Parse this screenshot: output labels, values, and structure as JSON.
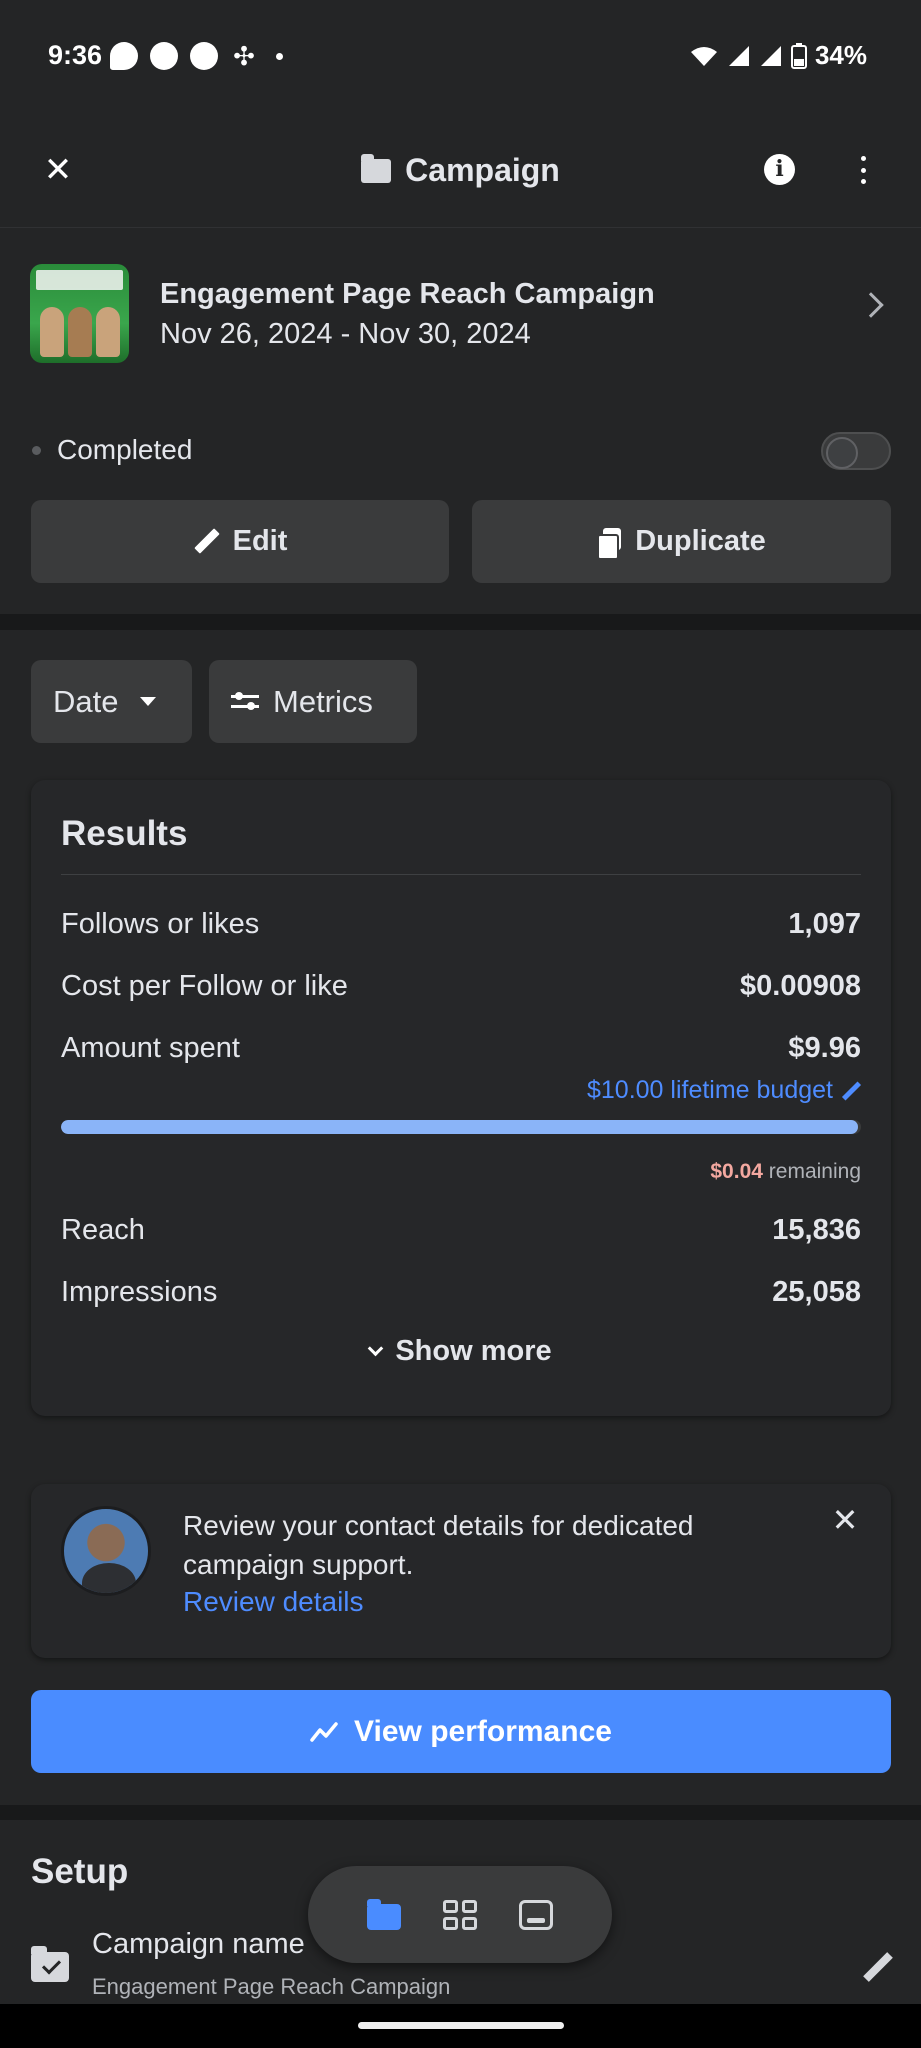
{
  "status_bar": {
    "time": "9:36",
    "battery": "34%",
    "left_icons": [
      "messenger-icon",
      "facebook-icon",
      "facebook-icon",
      "slack-icon",
      "notification-dot"
    ],
    "right_icons": [
      "wifi-icon",
      "signal-icon",
      "signal-icon",
      "battery-icon"
    ]
  },
  "header": {
    "title": "Campaign",
    "close_icon": "close-icon",
    "info_icon": "info-icon",
    "more_icon": "more-vertical-icon"
  },
  "campaign": {
    "name": "Engagement Page Reach Campaign",
    "dates": "Nov 26, 2024 - Nov 30, 2024",
    "status": "Completed",
    "toggle_on": false,
    "edit_label": "Edit",
    "duplicate_label": "Duplicate"
  },
  "filters": {
    "date_label": "Date",
    "metrics_label": "Metrics"
  },
  "results": {
    "title": "Results",
    "metrics": [
      {
        "label": "Follows or likes",
        "value": "1,097"
      },
      {
        "label": "Cost per Follow or like",
        "value": "$0.00908"
      },
      {
        "label": "Amount spent",
        "value": "$9.96"
      }
    ],
    "budget_label": "$10.00 lifetime budget",
    "budget_progress": 0.996,
    "remaining_amount": "$0.04",
    "remaining_suffix": "remaining",
    "more_metrics": [
      {
        "label": "Reach",
        "value": "15,836"
      },
      {
        "label": "Impressions",
        "value": "25,058"
      }
    ],
    "show_more_label": "Show more"
  },
  "review": {
    "text": "Review your contact details for dedicated campaign support.",
    "link": "Review details"
  },
  "view_performance_label": "View performance",
  "setup": {
    "title": "Setup",
    "field_label": "Campaign name",
    "field_value": "Engagement Page Reach Campaign"
  },
  "colors": {
    "accent": "#4a8cff",
    "link": "#4e8cff",
    "background": "#18191a",
    "surface": "#242526"
  }
}
